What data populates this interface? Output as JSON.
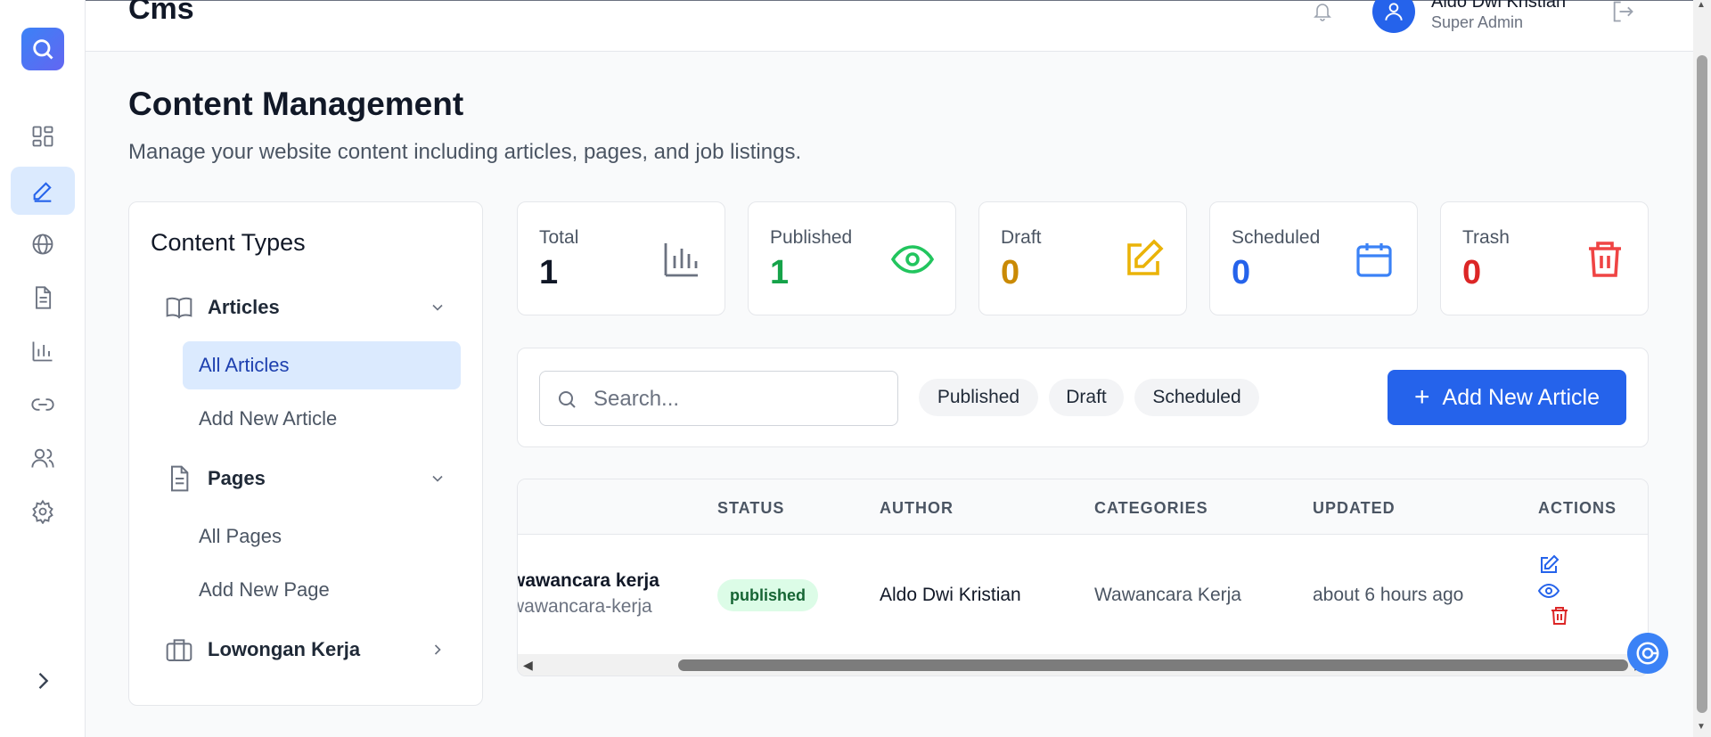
{
  "header": {
    "title": "Cms",
    "user_name": "Aldo Dwi Kristian",
    "user_role": "Super Admin"
  },
  "sidebar": {
    "items": [
      {
        "name": "dashboard-icon"
      },
      {
        "name": "pencil-icon",
        "active": true
      },
      {
        "name": "globe-icon"
      },
      {
        "name": "document-icon"
      },
      {
        "name": "bar-chart-icon"
      },
      {
        "name": "link-icon"
      },
      {
        "name": "users-icon"
      },
      {
        "name": "gear-icon"
      }
    ],
    "expand_icon": "chevron-right-icon"
  },
  "page": {
    "title": "Content Management",
    "subtitle": "Manage your website content including articles, pages, and job listings."
  },
  "content_types": {
    "title": "Content Types",
    "groups": [
      {
        "label": "Articles",
        "icon": "book-icon",
        "children": [
          "All Articles",
          "Add New Article"
        ]
      },
      {
        "label": "Pages",
        "icon": "document-icon",
        "children": [
          "All Pages",
          "Add New Page"
        ]
      },
      {
        "label": "Lowongan Kerja",
        "icon": "briefcase-icon",
        "children": []
      }
    ]
  },
  "stats": [
    {
      "label": "Total",
      "value": "1",
      "color": "#111827",
      "icon": "bar-chart-icon"
    },
    {
      "label": "Published",
      "value": "1",
      "color": "#16a34a",
      "icon": "eye-icon"
    },
    {
      "label": "Draft",
      "value": "0",
      "color": "#ca8a04",
      "icon": "edit-icon"
    },
    {
      "label": "Scheduled",
      "value": "0",
      "color": "#2563eb",
      "icon": "calendar-icon"
    },
    {
      "label": "Trash",
      "value": "0",
      "color": "#dc2626",
      "icon": "trash-icon"
    }
  ],
  "filters": {
    "search_placeholder": "Search...",
    "chips": [
      "Published",
      "Draft",
      "Scheduled"
    ],
    "add_button": "Add New Article",
    "add_icon": "+"
  },
  "table": {
    "columns": [
      "STATUS",
      "AUTHOR",
      "CATEGORIES",
      "UPDATED",
      "ACTIONS"
    ],
    "rows": [
      {
        "title": "wawancara kerja",
        "slug": "wawancara-kerja",
        "status": "published",
        "author": "Aldo Dwi Kristian",
        "categories": "Wawancara Kerja",
        "updated": "about 6 hours ago"
      }
    ]
  },
  "colors": {
    "accent": "#2563eb",
    "active_bg": "#dbeafe",
    "published_badge_bg": "#dcfce7",
    "published_badge_text": "#166534"
  }
}
